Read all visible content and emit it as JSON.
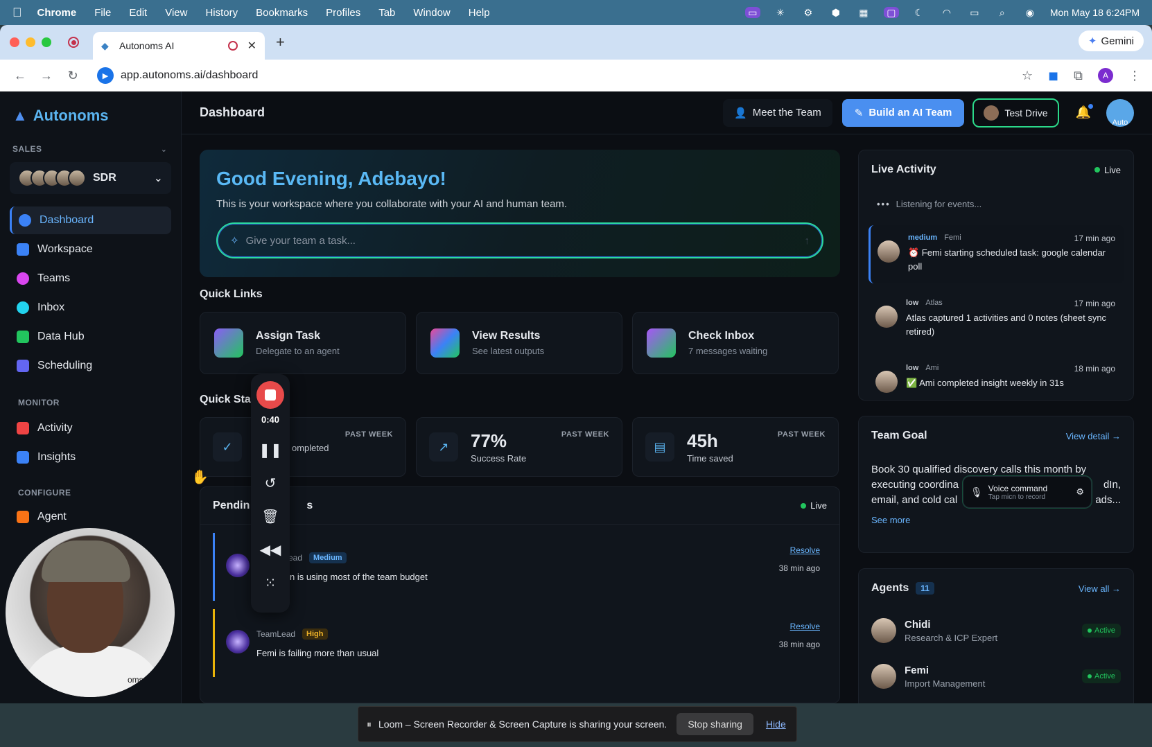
{
  "menubar": {
    "app": "Chrome",
    "items": [
      "File",
      "Edit",
      "View",
      "History",
      "Bookmarks",
      "Profiles",
      "Tab",
      "Window",
      "Help"
    ],
    "datetime": "Mon May 18  6:24PM"
  },
  "browser": {
    "tab_title": "Autonoms AI",
    "url": "app.autonoms.ai/dashboard",
    "gemini_label": "Gemini",
    "profile_initial": "A"
  },
  "sidebar": {
    "brand": "Autonoms",
    "section_sales": "SALES",
    "team_name": "SDR",
    "nav": [
      {
        "label": "Dashboard",
        "color": "#3b82f6"
      },
      {
        "label": "Workspace",
        "color": "#3b82f6"
      },
      {
        "label": "Teams",
        "color": "#d946ef"
      },
      {
        "label": "Inbox",
        "color": "#22d3ee"
      },
      {
        "label": "Data Hub",
        "color": "#22c55e"
      },
      {
        "label": "Scheduling",
        "color": "#6366f1"
      }
    ],
    "section_monitor": "MONITOR",
    "monitor": [
      {
        "label": "Activity",
        "color": "#ef4444"
      },
      {
        "label": "Insights",
        "color": "#3b82f6"
      }
    ],
    "section_configure": "CONFIGURE",
    "configure_partial": "Agent"
  },
  "topbar": {
    "title": "Dashboard",
    "meet_team": "Meet the Team",
    "build_team": "Build an AI Team",
    "test_drive": "Test Drive",
    "avatar_text": "Auto"
  },
  "hero": {
    "greeting": "Good Evening, Adebayo!",
    "subtitle": "This is your workspace where you collaborate with your AI and human team.",
    "task_placeholder": "Give your team a task..."
  },
  "quick_links": {
    "heading": "Quick Links",
    "items": [
      {
        "title": "Assign Task",
        "sub": "Delegate to an agent"
      },
      {
        "title": "View Results",
        "sub": "See latest outputs"
      },
      {
        "title": "Check Inbox",
        "sub": "7 messages waiting"
      }
    ]
  },
  "quick_stats": {
    "heading": "Quick Sta",
    "items": [
      {
        "value": "",
        "label": "ompleted",
        "period": "PAST WEEK"
      },
      {
        "value": "77%",
        "label": "Success Rate",
        "period": "PAST WEEK"
      },
      {
        "value": "45h",
        "label": "Time saved",
        "period": "PAST WEEK"
      }
    ]
  },
  "pending": {
    "heading": "Pendin",
    "heading_tail": "s",
    "live": "Live",
    "items": [
      {
        "source": "ead",
        "priority": "Medium",
        "message": "n is using most of the team budget",
        "resolve": "Resolve",
        "time": "38 min ago"
      },
      {
        "source": "TeamLead",
        "priority": "High",
        "message": "Femi is failing more than usual",
        "resolve": "Resolve",
        "time": "38 min ago"
      }
    ]
  },
  "live_activity": {
    "title": "Live Activity",
    "live": "Live",
    "listening": "Listening for events...",
    "events": [
      {
        "level": "medium",
        "agent": "Femi",
        "time": "17 min ago",
        "text": "⏰ Femi starting scheduled task: google calendar poll"
      },
      {
        "level": "low",
        "agent": "Atlas",
        "time": "17 min ago",
        "text": "Atlas captured 1 activities and 0 notes (sheet sync retired)"
      },
      {
        "level": "low",
        "agent": "Ami",
        "time": "18 min ago",
        "text": "✅ Ami completed insight weekly in 31s"
      }
    ]
  },
  "team_goal": {
    "title": "Team Goal",
    "view_detail": "View detail →",
    "text_l1": "Book 30 qualified discovery calls this month by",
    "text_l2": "executing coordina",
    "text_l2_tail": "dIn,",
    "text_l3": "email, and cold cal",
    "text_l3_tail": "ads...",
    "see_more": "See more",
    "voice_title": "Voice command",
    "voice_sub": "Tap micn to record"
  },
  "agents": {
    "title": "Agents",
    "count": "11",
    "view_all": "View all →",
    "items": [
      {
        "name": "Chidi",
        "role": "Research & ICP Expert",
        "status": "Active"
      },
      {
        "name": "Femi",
        "role": "Import Management",
        "status": "Active"
      }
    ]
  },
  "loom": {
    "timer": "0:40",
    "banner_text": "Loom – Screen Recorder & Screen Capture is sharing your screen.",
    "stop_sharing": "Stop sharing",
    "hide": "Hide"
  },
  "webcam": {
    "overlay_text": "oms-..."
  }
}
